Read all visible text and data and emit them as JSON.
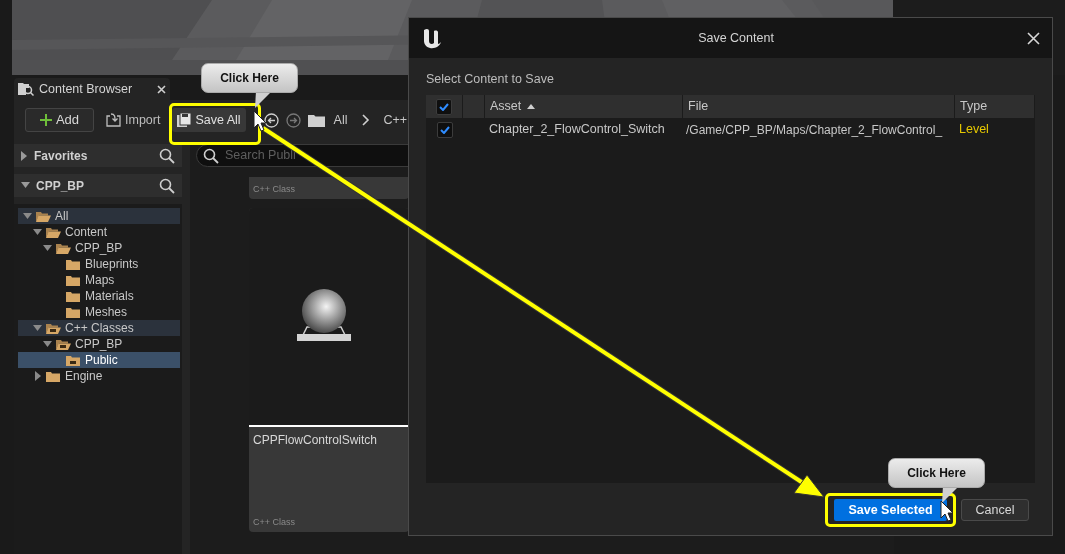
{
  "content_browser": {
    "tab_title": "Content Browser",
    "toolbar": {
      "add": "Add",
      "import": "Import",
      "save_all": "Save All",
      "breadcrumbs": [
        "All",
        "C++"
      ]
    },
    "sections": [
      {
        "label": "Favorites",
        "expanded": false
      },
      {
        "label": "CPP_BP",
        "expanded": true
      }
    ],
    "tree": [
      {
        "label": "All",
        "kind": "folder",
        "expanded": true,
        "highlighted": true,
        "selected": false,
        "children": [
          {
            "label": "Content",
            "kind": "folder",
            "expanded": true,
            "highlighted": false,
            "selected": false,
            "children": [
              {
                "label": "CPP_BP",
                "kind": "folder",
                "expanded": true,
                "highlighted": false,
                "selected": false,
                "children": [
                  {
                    "label": "Blueprints",
                    "kind": "folder",
                    "highlighted": false,
                    "selected": false
                  },
                  {
                    "label": "Maps",
                    "kind": "folder",
                    "highlighted": false,
                    "selected": false
                  },
                  {
                    "label": "Materials",
                    "kind": "folder",
                    "highlighted": false,
                    "selected": false
                  },
                  {
                    "label": "Meshes",
                    "kind": "folder",
                    "highlighted": false,
                    "selected": false
                  }
                ]
              }
            ]
          },
          {
            "label": "C++ Classes",
            "kind": "cpp_folder",
            "expanded": true,
            "highlighted": true,
            "selected": false,
            "children": [
              {
                "label": "CPP_BP",
                "kind": "cpp_folder",
                "expanded": true,
                "highlighted": false,
                "selected": false,
                "children": [
                  {
                    "label": "Public",
                    "kind": "cpp_folder",
                    "highlighted": false,
                    "selected": true
                  }
                ]
              }
            ]
          },
          {
            "label": "Engine",
            "kind": "folder",
            "expanded": false,
            "highlighted": false,
            "selected": false
          }
        ]
      }
    ],
    "search": {
      "placeholder": "Search Publi"
    },
    "cards": [
      {
        "type": "C++ Class"
      },
      {
        "name": "CPPFlowControlSwitch",
        "type": "C++ Class"
      }
    ]
  },
  "dialog": {
    "title": "Save Content",
    "prompt": "Select Content to Save",
    "header_checked": true,
    "columns": [
      "Asset",
      "File",
      "Type"
    ],
    "rows": [
      {
        "checked": true,
        "asset": "Chapter_2_FlowControl_Switch",
        "file": "/Game/CPP_BP/Maps/Chapter_2_FlowControl_",
        "type": "Level"
      }
    ],
    "buttons": {
      "save": "Save Selected",
      "cancel": "Cancel"
    }
  },
  "callouts": [
    {
      "text": "Click Here"
    },
    {
      "text": "Click Here"
    }
  ]
}
